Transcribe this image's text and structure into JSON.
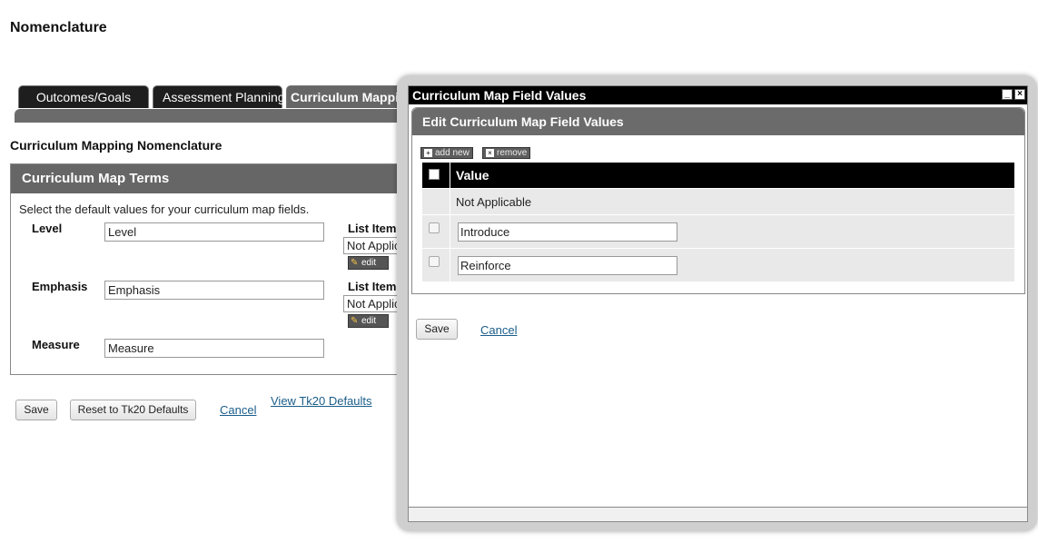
{
  "page": {
    "title": "Nomenclature",
    "section_heading": "Curriculum Mapping Nomenclature"
  },
  "tabs": [
    {
      "label": "Outcomes/Goals"
    },
    {
      "label": "Assessment Planning"
    },
    {
      "label": "Curriculum Mappin"
    }
  ],
  "terms": {
    "header": "Curriculum Map Terms",
    "description": "Select the default values for your curriculum map fields.",
    "list_items_label": "List Item",
    "edit_label": "edit",
    "fields": [
      {
        "label": "Level",
        "value": "Level",
        "list_value": "Not Applic"
      },
      {
        "label": "Emphasis",
        "value": "Emphasis",
        "list_value": "Not Applic"
      },
      {
        "label": "Measure",
        "value": "Measure"
      }
    ]
  },
  "actions": {
    "save": "Save",
    "reset": "Reset to Tk20 Defaults",
    "cancel": "Cancel",
    "view_defaults": "View Tk20 Defaults"
  },
  "modal": {
    "title": "Curriculum Map Field Values",
    "minimize": "_",
    "close": "×",
    "panel_header": "Edit Curriculum Map Field Values",
    "add_new": "add new",
    "remove": "remove",
    "table_header": "Value",
    "rows": [
      {
        "value": "Not Applicable",
        "editable": false
      },
      {
        "value": "Introduce",
        "editable": true
      },
      {
        "value": "Reinforce",
        "editable": true
      }
    ],
    "save": "Save",
    "cancel": "Cancel"
  }
}
